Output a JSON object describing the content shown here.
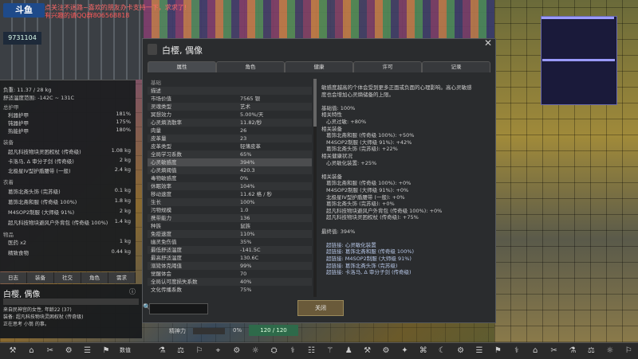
{
  "stream": {
    "logo": "斗鱼",
    "room_id": "9731104",
    "danmu_1": "点关注不迷路~喜欢的朋友办卡支持一下，求求了!",
    "danmu_2": "有兴趣的请QQ群806568818"
  },
  "left_panel": {
    "weight": "负重: 11.37 / 28 kg",
    "comfort_temp": "舒适温度范围: -142C ~ 131C",
    "armor_head": "总护甲",
    "armor_rows": [
      {
        "label": "利器护甲",
        "value": "181%"
      },
      {
        "label": "钝器护甲",
        "value": "175%"
      },
      {
        "label": "热能护甲",
        "value": "180%"
      }
    ],
    "equip_head": "装备",
    "equip_rows": [
      {
        "label": "超凡科技物块灵困权杖 (传奇级)",
        "value": "1.08 kg"
      },
      {
        "label": "卡洛马, Δ 审分子剑 (传奇级)",
        "value": "2 kg"
      },
      {
        "label": "北极星IV型护盾腰带 (一般)",
        "value": "2.4 kg"
      }
    ],
    "apparel_head": "衣着",
    "apparel_rows": [
      {
        "label": "葛饰北斋头饰 (完苏级)",
        "value": "0.1 kg"
      },
      {
        "label": "葛饰北斋和服 (传奇级 100%)",
        "value": "1.8 kg"
      },
      {
        "label": "M4SOP2制服 (大师级 91%)",
        "value": "2 kg"
      },
      {
        "label": "超凡科技物块避风户外背包 (传奇级 100%)",
        "value": "1.4 kg"
      }
    ],
    "items_head": "物品",
    "items_rows": [
      {
        "label": "医药 x2",
        "value": "1 kg"
      },
      {
        "label": "精致食物",
        "value": "0.44 kg"
      }
    ],
    "tabs": [
      "日志",
      "装备",
      "社交",
      "角色",
      "需求"
    ],
    "pawn_name": "白樱, 偶像",
    "pawn_sub": "来自民神宫的女性, 年龄22 (37)",
    "pawn_equip": "装备: 超凡科技物块灵困权杖 (传奇级)",
    "pawn_status": "正在思考 小翁 的事。",
    "mood_label": "精神力",
    "mood_value": "0%",
    "health_value": "120 / 120"
  },
  "dialog": {
    "title": "白樱, 偶像",
    "tabs": [
      "属性",
      "角色",
      "健康",
      "许可",
      "记录"
    ],
    "stats": [
      {
        "label": "基础",
        "value": "",
        "section": true
      },
      {
        "label": "描述",
        "value": ""
      },
      {
        "label": "市场价值",
        "value": "7565 银"
      },
      {
        "label": "灵魂类型",
        "value": "艺术"
      },
      {
        "label": "冥想效力",
        "value": "5.00%/天"
      },
      {
        "label": "心灵熵消散率",
        "value": "11.82/秒"
      },
      {
        "label": "肉量",
        "value": "26"
      },
      {
        "label": "皮革量",
        "value": "23"
      },
      {
        "label": "皮革类型",
        "value": "轻薄皮革"
      },
      {
        "label": "全局学习系数",
        "value": "65%"
      },
      {
        "label": "心灵敏感度",
        "value": "394%",
        "sel": true
      },
      {
        "label": "心灵熵阈值",
        "value": "420.3"
      },
      {
        "label": "毒物敏感度",
        "value": "0%"
      },
      {
        "label": "休眠效率",
        "value": "104%"
      },
      {
        "label": "移动速度",
        "value": "11.62 格 / 秒"
      },
      {
        "label": "生长",
        "value": "100%"
      },
      {
        "label": "污物规模",
        "value": "1.0"
      },
      {
        "label": "携带能力",
        "value": "136"
      },
      {
        "label": "种族",
        "value": "鼠族"
      },
      {
        "label": "免疫速度",
        "value": "110%"
      },
      {
        "label": "幽灵免伤值",
        "value": "35%"
      },
      {
        "label": "最低舒适温度",
        "value": "-141.5C"
      },
      {
        "label": "最高舒适温度",
        "value": "130.6C"
      },
      {
        "label": "溺毙体克阈值",
        "value": "99%"
      },
      {
        "label": "觉醒体会",
        "value": "70"
      },
      {
        "label": "全局认可度损失系数",
        "value": "40%"
      },
      {
        "label": "文化传播系数",
        "value": "75%"
      }
    ],
    "detail": [
      {
        "t": "敏感度越高的个体会受到更多正面或负面的心理影响。高心灵敏感",
        "i": false
      },
      {
        "t": "度也会增加心灵熵储备的上限。",
        "i": false
      },
      {
        "t": "",
        "i": false
      },
      {
        "t": "基础值: 100%",
        "i": false
      },
      {
        "t": "相关特性",
        "i": false
      },
      {
        "t": "心灵过敏: +80%",
        "i": true
      },
      {
        "t": "相关装备",
        "i": false
      },
      {
        "t": "葛饰北斋和服 (传奇级 100%): +50%",
        "i": true
      },
      {
        "t": "M4SOP2制服 (大师级 91%): +42%",
        "i": true
      },
      {
        "t": "葛饰北斋头饰 (完苏级): +22%",
        "i": true
      },
      {
        "t": "相关健康状况",
        "i": false
      },
      {
        "t": "心灵敏化装置: +25%",
        "i": true
      },
      {
        "t": "",
        "i": false
      },
      {
        "t": "相关装备",
        "i": false
      },
      {
        "t": "葛饰北斋和服 (传奇级 100%): +0%",
        "i": true
      },
      {
        "t": "M4SOP2制服 (大师级 91%): +0%",
        "i": true
      },
      {
        "t": "北极星IV型护盾腰带 (一般): +0%",
        "i": true
      },
      {
        "t": "葛饰北斋头饰 (完苏级): +0%",
        "i": true
      },
      {
        "t": "超凡科技物块避风户外背包 (传奇级 100%): +0%",
        "i": true
      },
      {
        "t": "超凡科技物块灵困权杖 (传奇级): +75%",
        "i": true
      },
      {
        "t": "",
        "i": false
      },
      {
        "t": "最终值: 394%",
        "i": false
      },
      {
        "t": "",
        "i": false
      },
      {
        "t": "超链接: 心灵敏化装置",
        "i": true
      },
      {
        "t": "超链接: 葛饰北斋和服 (传奇级 100%)",
        "i": true
      },
      {
        "t": "超链接: M4SOP2制服 (大师级 91%)",
        "i": true
      },
      {
        "t": "超链接: 葛饰北斋头饰 (完苏级)",
        "i": true
      },
      {
        "t": "超链接: 卡洛马, Δ 审分子剑 (传奇级)",
        "i": true
      }
    ],
    "close_label": "关闭",
    "search_placeholder": ""
  },
  "bottombar": {
    "menu_label": "数值"
  }
}
